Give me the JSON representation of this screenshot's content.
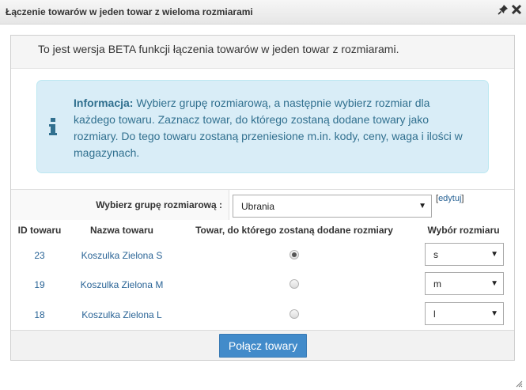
{
  "window": {
    "title": "Łączenie towarów w jeden towar z wieloma rozmiarami",
    "pin_icon": "pin-icon",
    "close_icon": "close-icon"
  },
  "beta_notice": "To jest wersja BETA funkcji łączenia towarów w jeden towar z rozmiarami.",
  "info": {
    "icon": "info-icon",
    "heading": "Informacja:",
    "text": " Wybierz grupę rozmiarową, a następnie wybierz rozmiar dla każdego towaru. Zaznacz towar, do którego zostaną dodane towary jako rozmiary. Do tego towaru zostaną przeniesione m.in. kody, ceny, waga i ilości w magazynach."
  },
  "size_group": {
    "label": "Wybierz grupę rozmiarową :",
    "selected": "Ubrania",
    "edit_open": "[",
    "edit_link": "edytuj",
    "edit_close": "]"
  },
  "table": {
    "columns": [
      "ID towaru",
      "Nazwa towaru",
      "Towar, do którego zostaną dodane rozmiary",
      "Wybór rozmiaru"
    ],
    "rows": [
      {
        "id": "23",
        "name": "Koszulka Zielona S",
        "target": true,
        "size": "s"
      },
      {
        "id": "19",
        "name": "Koszulka Zielona M",
        "target": false,
        "size": "m"
      },
      {
        "id": "18",
        "name": "Koszulka Zielona L",
        "target": false,
        "size": "l"
      }
    ]
  },
  "merge_button": "Połącz towary",
  "colors": {
    "accent": "#428bca",
    "info_bg": "#d9edf7",
    "info_text": "#31708f",
    "link": "#2a6496"
  }
}
